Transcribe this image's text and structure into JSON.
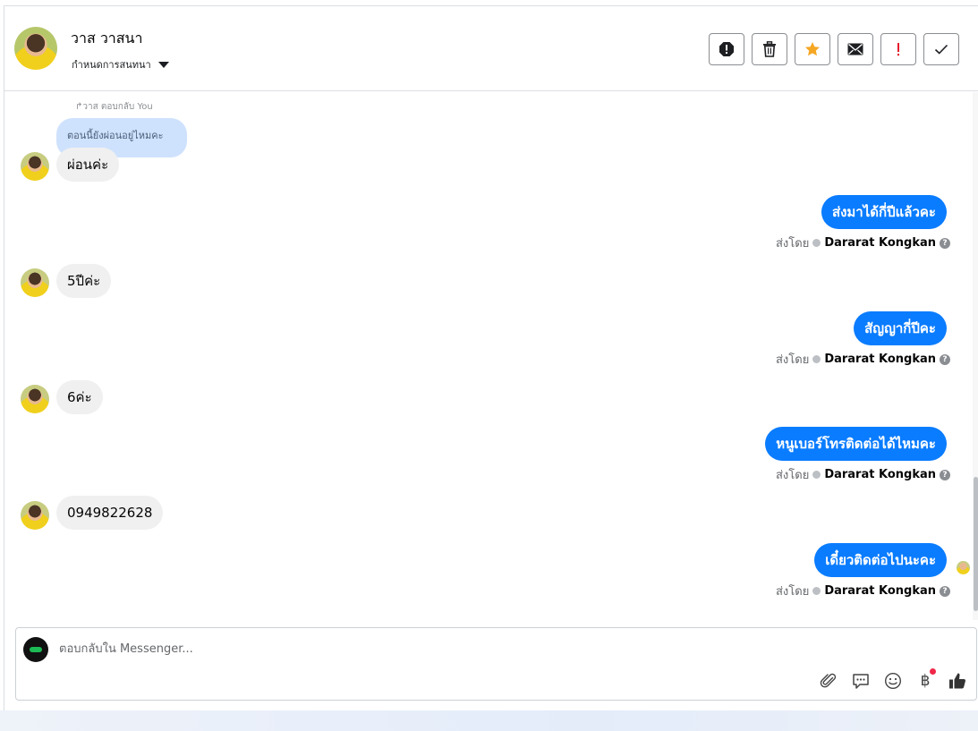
{
  "header": {
    "name": "วาส วาสนา",
    "subtitle": "กำหนดการสนทนา",
    "actions": [
      "spam-icon",
      "trash-icon",
      "star-icon",
      "mail-icon",
      "important-icon",
      "check-icon"
    ]
  },
  "thread": {
    "reply_label": "↱วาส ตอบกลับ You",
    "quoted_text": "ตอนนี้ยังผ่อนอยู่ไหมคะ",
    "messages": [
      {
        "dir": "in",
        "text": "ผ่อนค่ะ"
      },
      {
        "dir": "out",
        "text": "ส่งมาได้กี่ปีแล้วคะ",
        "sent_by_label": "ส่งโดย",
        "sender": "Dararat Kongkan"
      },
      {
        "dir": "in",
        "text": "5ปีค่ะ"
      },
      {
        "dir": "out",
        "text": "สัญญากี่ปีคะ",
        "sent_by_label": "ส่งโดย",
        "sender": "Dararat Kongkan"
      },
      {
        "dir": "in",
        "text": "6ค่ะ"
      },
      {
        "dir": "out",
        "text": "หนูเบอร์โทรติดต่อได้ไหมคะ",
        "sent_by_label": "ส่งโดย",
        "sender": "Dararat Kongkan"
      },
      {
        "dir": "in",
        "text": "0949822628"
      },
      {
        "dir": "out",
        "text": "เดี๋ยวติดต่อไปนะคะ",
        "sent_by_label": "ส่งโดย",
        "sender": "Dararat Kongkan"
      }
    ]
  },
  "composer": {
    "placeholder": "ตอบกลับใน Messenger...",
    "tools": [
      "paperclip-icon",
      "chat-bubble-icon",
      "emoji-icon",
      "baht-icon",
      "thumbs-up-icon"
    ],
    "baht_symbol": "฿"
  },
  "colors": {
    "outgoing": "#0a7cff",
    "incoming": "#f0f0f0",
    "quoted": "#cfe2fd",
    "star": "#f5a623",
    "important": "#e4192c"
  }
}
